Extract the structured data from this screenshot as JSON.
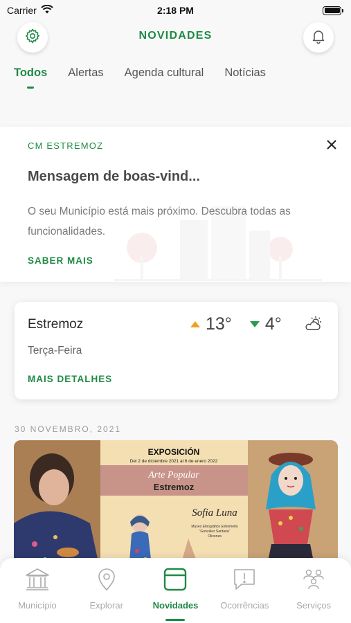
{
  "status_bar": {
    "carrier": "Carrier",
    "time": "2:18 PM"
  },
  "header": {
    "title": "NOVIDADES"
  },
  "tabs": [
    {
      "label": "Todos",
      "active": true
    },
    {
      "label": "Alertas",
      "active": false
    },
    {
      "label": "Agenda cultural",
      "active": false
    },
    {
      "label": "Notícias",
      "active": false
    }
  ],
  "welcome_card": {
    "source": "CM ESTREMOZ",
    "title": "Mensagem de boas-vind...",
    "body": "O seu Município está mais próximo. Descubra todas as funcionalidades.",
    "link": "SABER MAIS"
  },
  "weather_card": {
    "city": "Estremoz",
    "day": "Terça-Feira",
    "max_temp": "13°",
    "min_temp": "4°",
    "icon": "partly-cloudy-icon",
    "link": "MAIS DETALHES"
  },
  "feed": {
    "date": "30 NOVEMBRO, 2021",
    "poster": {
      "heading": "EXPOSICIÓN",
      "dates": "Del 2 de diciembre 2021 al 6 de enero 2022",
      "subtitle": "Arte Popular",
      "place": "Estremoz",
      "artist": "Sofia Luna",
      "venue_line1": "Museo Etnográfico Extremeño",
      "venue_line2": "\"González Santana\"",
      "venue_line3": "Olivenza"
    }
  },
  "bottom_nav": [
    {
      "label": "Município",
      "icon": "building-icon",
      "active": false
    },
    {
      "label": "Explorar",
      "icon": "map-pin-icon",
      "active": false
    },
    {
      "label": "Novidades",
      "icon": "news-icon",
      "active": true
    },
    {
      "label": "Ocorrências",
      "icon": "report-icon",
      "active": false
    },
    {
      "label": "Serviços",
      "icon": "services-icon",
      "active": false
    }
  ],
  "colors": {
    "accent": "#1e8a45",
    "temp_up": "#f0a020",
    "temp_down": "#2a9a55"
  }
}
